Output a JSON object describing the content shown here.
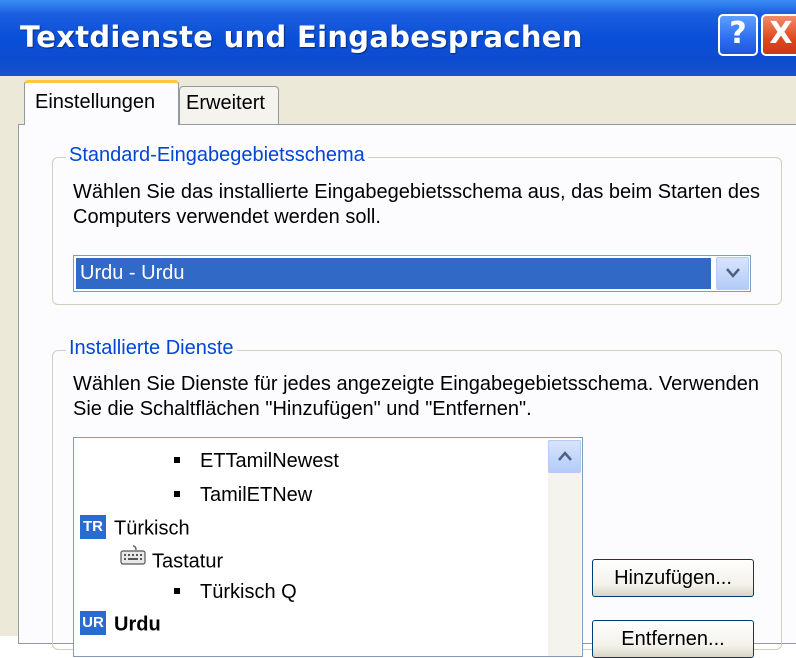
{
  "window": {
    "title": "Textdienste und Eingabesprachen",
    "help_symbol": "?",
    "close_symbol": "X"
  },
  "tabs": [
    {
      "label": "Einstellungen",
      "active": true
    },
    {
      "label": "Erweitert",
      "active": false
    }
  ],
  "default_schema": {
    "legend": "Standard-Eingabegebietsschema",
    "description": "Wählen Sie das installierte Eingabegebietsschema aus, das beim Starten des Computers verwendet werden soll.",
    "selected": "Urdu - Urdu"
  },
  "installed": {
    "legend": "Installierte Dienste",
    "description": "Wählen Sie Dienste für jedes angezeigte Eingabegebietsschema. Verwenden Sie die Schaltflächen \"Hinzufügen\" und \"Entfernen\".",
    "items": [
      {
        "text": "ETTamilNewest",
        "kind": "layout"
      },
      {
        "text": "TamilETNew",
        "kind": "layout"
      },
      {
        "text": "Türkisch",
        "kind": "language",
        "badge": "TR"
      },
      {
        "text": "Tastatur",
        "kind": "category"
      },
      {
        "text": "Türkisch Q",
        "kind": "layout"
      },
      {
        "text": "Urdu",
        "kind": "language",
        "badge": "UR",
        "bold": true
      }
    ]
  },
  "buttons": {
    "add": "Hinzufügen...",
    "remove": "Entfernen..."
  },
  "colors": {
    "titlebar": "#0a4fd8",
    "selection": "#3169c6",
    "legend_text": "#0046d5",
    "dialog_bg": "#ece9d8"
  }
}
